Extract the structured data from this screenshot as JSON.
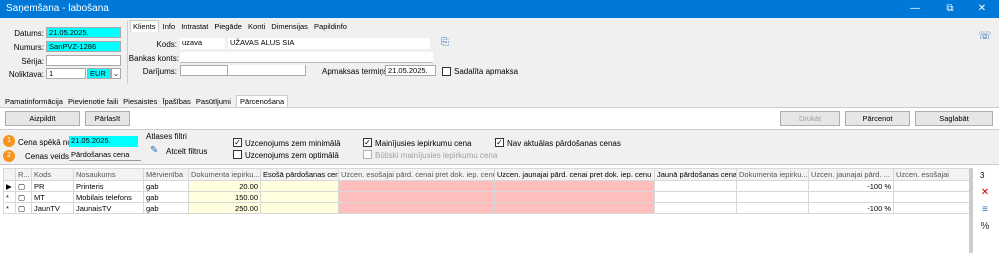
{
  "window": {
    "title": "Saņemšana - labošana",
    "controls": [
      "—",
      "⧉",
      "✕"
    ]
  },
  "header": {
    "datums_label": "Datums:",
    "datums_value": "21.05.2025.",
    "numurs_label": "Numurs:",
    "numurs_value": "SanPVZ-1286",
    "serija_label": "Sērija:",
    "serija_value": "",
    "noliktava_label": "Noliktava:",
    "noliktava_value": "1",
    "currency_value": "EUR"
  },
  "client_tabs": [
    "Klients",
    "Info",
    "Intrastat",
    "Piegāde",
    "Konti",
    "Dimensijas",
    "Papildinfo"
  ],
  "client": {
    "kods_label": "Kods:",
    "kods_value": "uzava",
    "name_value": "UŽAVAS ALUS SIA",
    "bankas_label": "Bankas konts:",
    "darijums_label": "Darījums:",
    "apmaksas_label": "Apmaksas termiņš:",
    "apmaksas_value": "21.05.2025.",
    "sadalita_label": "Sadalīta apmaksa"
  },
  "main_tabs": [
    "Pamatinformācija",
    "Pievienotie faili",
    "Piesaistes",
    "Īpašības",
    "Pasūtījumi",
    "Pārcenošana"
  ],
  "toolbar": {
    "aizpildit": "Aizpildīt",
    "parlasit": "Pārlasīt",
    "druket": "Drukāt",
    "parcenot": "Pārcenot",
    "saglabat": "Saglabāt"
  },
  "filters": {
    "cena_label": "Cena spēkā no:",
    "cena_value": "21.05.2025.",
    "veids_label": "Cenas veids:",
    "veids_value": "Pārdošanas cena",
    "atlases_label": "Atlases filtri",
    "atcelt_label": "Atcelt filtrus",
    "cb1": "Uzcenojums zem minimālā",
    "cb2": "Uzcenojums zem optimālā",
    "cb3": "Mainījusies iepirkumu cena",
    "cb4": "Būtiski mainījusies iepirkumu cena",
    "cb5": "Nav aktuālas pārdošanas cenas",
    "badge1": "1",
    "badge2": "2"
  },
  "grid": {
    "columns": [
      "R...",
      "Kods",
      "Nosaukums",
      "Mērvienība",
      "Dokumenta iepirku...",
      "Esošā pārdošanas cena",
      "Uzcen. esošajai pārd. cenai pret dok. iep. cenu",
      "Uzcen. jaunajai pārd. cenai pret dok. iep. cenu",
      "Jaunā pārdošanas cena",
      "Dokumenta iepirku...",
      "Uzcen. jaunajai pārd. ...",
      "Uzcen. esošajai"
    ],
    "rows": [
      {
        "kods": "PR",
        "nosaukums": "Printeris",
        "merv": "gab",
        "dok": "20.00",
        "uzj": "-100 %"
      },
      {
        "kods": "MT",
        "nosaukums": "Mobilais telefons",
        "merv": "gab",
        "dok": "150.00",
        "uzj": ""
      },
      {
        "kods": "JaunTV",
        "nosaukums": "JaunaisTV",
        "merv": "gab",
        "dok": "250.00",
        "uzj": "-100 %"
      }
    ],
    "row_count": "3"
  },
  "side_tools": [
    "✕",
    "≡",
    "%"
  ]
}
